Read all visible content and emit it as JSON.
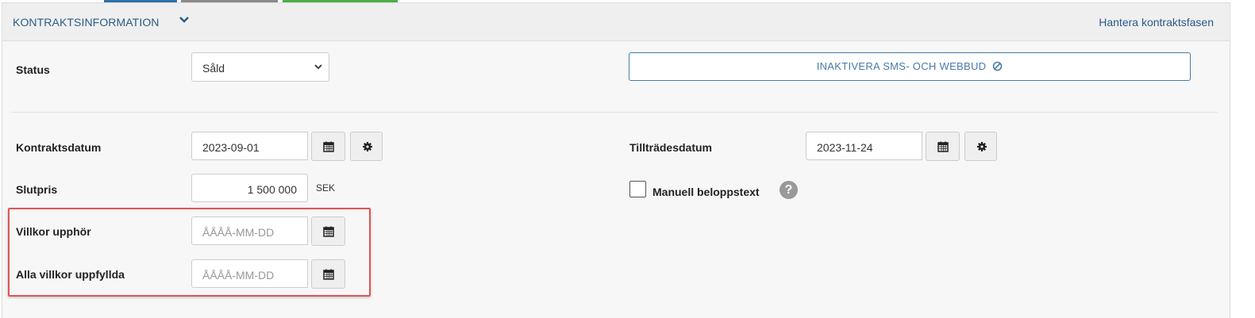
{
  "header": {
    "title": "KONTRAKTSINFORMATION",
    "manage_link": "Hantera kontraktsfasen"
  },
  "status": {
    "label": "Status",
    "selected": "Såld"
  },
  "sms_button": {
    "label": "INAKTIVERA SMS- OCH WEBBUD"
  },
  "kontraktsdatum": {
    "label": "Kontraktsdatum",
    "value": "2023-09-01"
  },
  "tilltradesdatum": {
    "label": "Tillträdesdatum",
    "value": "2023-11-24"
  },
  "slutpris": {
    "label": "Slutpris",
    "value": "1 500 000",
    "unit": "SEK"
  },
  "manuell": {
    "label": "Manuell beloppstext",
    "help": "?"
  },
  "villkor_upphor": {
    "label": "Villkor upphör",
    "placeholder": "ÅÅÅÅ-MM-DD"
  },
  "alla_villkor": {
    "label": "Alla villkor uppfyllda",
    "placeholder": "ÅÅÅÅ-MM-DD"
  },
  "colors": {
    "accent": "#2a5a8a",
    "highlight": "#e05555"
  }
}
